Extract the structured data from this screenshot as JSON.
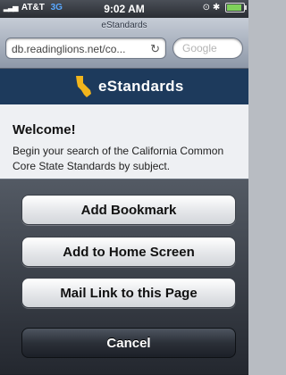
{
  "status_bar": {
    "carrier": "AT&T",
    "network": "3G",
    "time": "9:02 AM",
    "battery_icon": "battery-icon",
    "signal_icon": "signal-bars-icon"
  },
  "browser": {
    "page_title": "eStandards",
    "url": "db.readinglions.net/co...",
    "reload_icon": "reload-icon",
    "search_placeholder": "Google"
  },
  "site": {
    "name": "eStandards",
    "logo_icon": "california-state-icon",
    "logo_color": "#f2b51c"
  },
  "content": {
    "heading": "Welcome!",
    "intro": "Begin your search of the California Common Core State Standards by subject."
  },
  "action_sheet": {
    "buttons": [
      {
        "label": "Add Bookmark"
      },
      {
        "label": "Add to Home Screen"
      },
      {
        "label": "Mail Link to this Page"
      }
    ],
    "cancel_label": "Cancel"
  }
}
